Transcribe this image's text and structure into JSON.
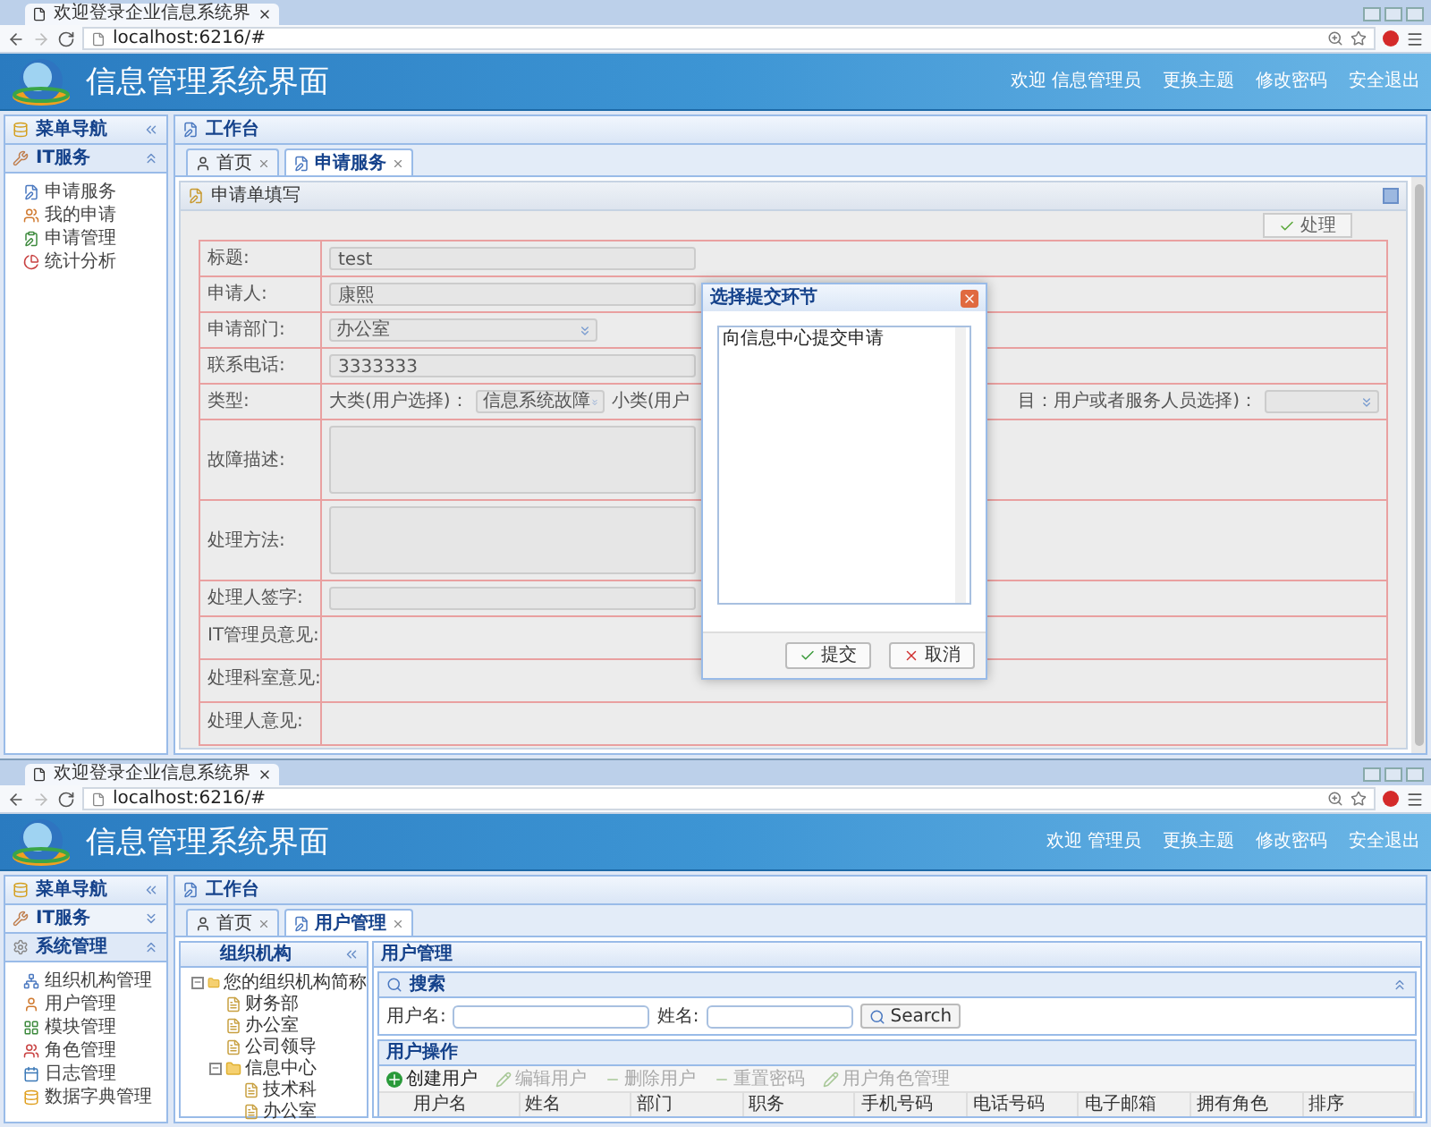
{
  "top_window": {
    "browser": {
      "tab_title": "欢迎登录企业信息系统界",
      "url": "localhost:6216/#"
    },
    "header": {
      "title": "信息管理系统界面",
      "links": [
        "欢迎 信息管理员",
        "更换主题",
        "修改密码",
        "安全退出"
      ]
    },
    "sidebar": {
      "title": "菜单导航",
      "groups": [
        {
          "label": "IT服务",
          "expanded": true,
          "items": [
            "申请服务",
            "我的申请",
            "申请管理",
            "统计分析"
          ]
        }
      ]
    },
    "workbench": "工作台",
    "tabs": [
      {
        "label": "首页",
        "selected": false
      },
      {
        "label": "申请服务",
        "selected": true
      }
    ],
    "form": {
      "title": "申请单填写",
      "action": "处理",
      "rows": [
        {
          "label": "标题:",
          "kind": "input",
          "value": "test"
        },
        {
          "label": "申请人:",
          "kind": "input",
          "value": "康熙"
        },
        {
          "label": "申请部门:",
          "kind": "select",
          "value": "办公室"
        },
        {
          "label": "联系电话:",
          "kind": "input",
          "value": "3333333"
        },
        {
          "label": "类型:",
          "kind": "type",
          "major_label": "大类(用户选择)：",
          "major_value": "信息系统故障",
          "minor_label": "小类(用户",
          "item_label": "目：用户或者服务人员选择)："
        },
        {
          "label": "故障描述:",
          "kind": "textarea"
        },
        {
          "label": "处理方法:",
          "kind": "textarea"
        },
        {
          "label": "处理人签字:",
          "kind": "field"
        },
        {
          "label": "IT管理员意见:",
          "kind": "blank"
        },
        {
          "label": "处理科室意见:",
          "kind": "blank"
        },
        {
          "label": "处理人意见:",
          "kind": "blank"
        }
      ]
    },
    "dialog": {
      "title": "选择提交环节",
      "text": "向信息中心提交申请",
      "buttons": [
        "提交",
        "取消"
      ]
    }
  },
  "bottom_window": {
    "browser": {
      "tab_title": "欢迎登录企业信息系统界",
      "url": "localhost:6216/#"
    },
    "header": {
      "title": "信息管理系统界面",
      "links": [
        "欢迎 管理员",
        "更换主题",
        "修改密码",
        "安全退出"
      ]
    },
    "sidebar": {
      "title": "菜单导航",
      "groups": [
        {
          "label": "IT服务",
          "expanded": false
        },
        {
          "label": "系统管理",
          "expanded": true,
          "items": [
            "组织机构管理",
            "用户管理",
            "模块管理",
            "角色管理",
            "日志管理",
            "数据字典管理"
          ]
        }
      ]
    },
    "workbench": "工作台",
    "tabs": [
      {
        "label": "首页",
        "selected": false
      },
      {
        "label": "用户管理",
        "selected": true
      }
    ],
    "org_panel": {
      "title": "组织机构",
      "tree": [
        {
          "label": "您的组织机构简称",
          "expanded": true,
          "children": [
            {
              "label": "财务部"
            },
            {
              "label": "办公室"
            },
            {
              "label": "公司领导"
            },
            {
              "label": "信息中心",
              "expanded": true,
              "children": [
                {
                  "label": "技术科"
                },
                {
                  "label": "办公室"
                }
              ]
            }
          ]
        }
      ]
    },
    "user_panel": {
      "title": "用户管理",
      "search": {
        "title": "搜索",
        "fields": [
          {
            "label": "用户名:"
          },
          {
            "label": "姓名:"
          }
        ],
        "button": "Search"
      },
      "operations": {
        "title": "用户操作",
        "actions": [
          {
            "label": "创建用户",
            "disabled": false
          },
          {
            "label": "编辑用户",
            "disabled": true
          },
          {
            "label": "删除用户",
            "disabled": true
          },
          {
            "label": "重置密码",
            "disabled": true
          },
          {
            "label": "用户角色管理",
            "disabled": true
          }
        ],
        "columns": [
          "用户名",
          "姓名",
          "部门",
          "职务",
          "手机号码",
          "电话号码",
          "电子邮箱",
          "拥有角色",
          "排序"
        ]
      }
    }
  }
}
